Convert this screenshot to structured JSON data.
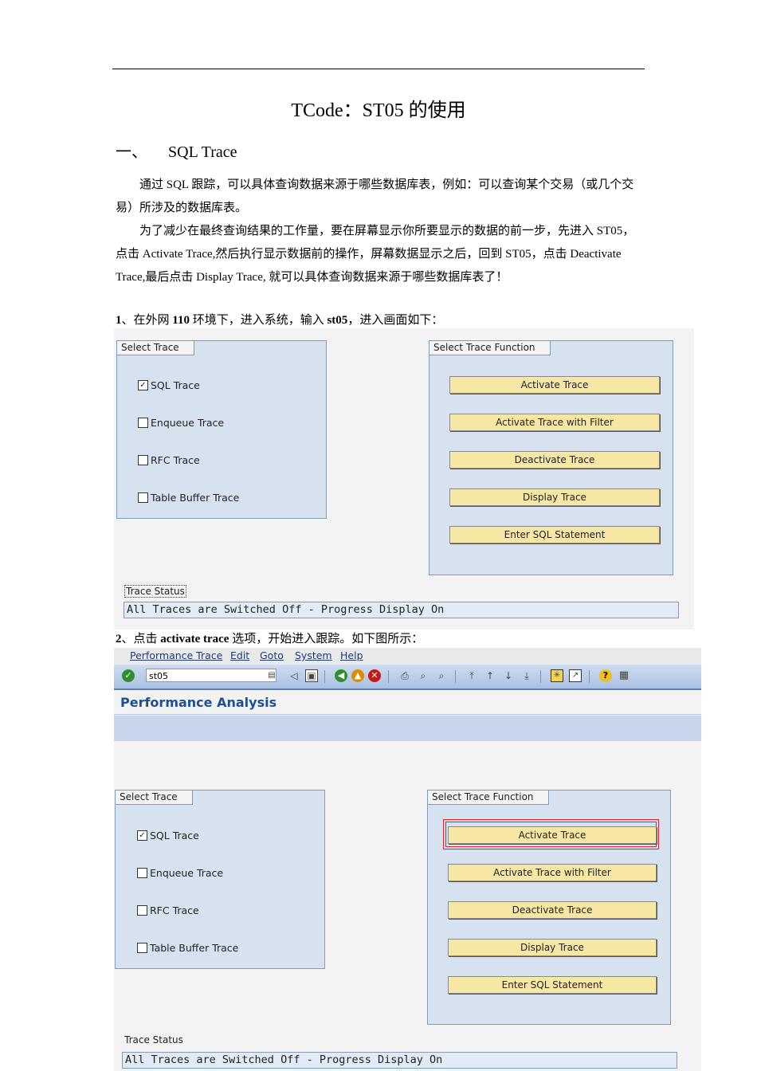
{
  "doc": {
    "title": "TCode：ST05 的使用",
    "section_number": "一、",
    "section_title": "SQL Trace",
    "paragraph1": "通过 SQL 跟踪，可以具体查询数据来源于哪些数据库表，例如：可以查询某个交易（或几个交易）所涉及的数据库表。",
    "paragraph2": "为了减少在最终查询结果的工作量，要在屏幕显示你所要显示的数据的前一步，先进入 ST05，点击 Activate Trace,然后执行显示数据前的操作，屏幕数据显示之后，回到 ST05，点击 Deactivate Trace,最后点击 Display Trace, 就可以具体查询数据来源于哪些数据库表了！",
    "step1": {
      "num": "1",
      "t1": "、在外网 ",
      "b1": "110",
      "t2": " 环境下，进入系统，输入 ",
      "b2": "st05",
      "t3": "，进入画面如下："
    },
    "step2": {
      "num": "2",
      "t1": "、点击 ",
      "b1": "activate trace",
      "t2": " 选项，开始进入跟踪。如下图所示："
    }
  },
  "sap": {
    "select_trace_title": "Select Trace",
    "select_function_title": "Select Trace Function",
    "checkboxes": [
      {
        "label": "SQL Trace",
        "checked": true
      },
      {
        "label": "Enqueue Trace",
        "checked": false
      },
      {
        "label": "RFC Trace",
        "checked": false
      },
      {
        "label": "Table Buffer Trace",
        "checked": false
      }
    ],
    "buttons": [
      "Activate Trace",
      "Activate Trace with Filter",
      "Deactivate Trace",
      "Display Trace",
      "Enter SQL Statement"
    ],
    "status_label": "Trace Status",
    "status_value": "All Traces are Switched Off - Progress Display On",
    "menu": [
      "Performance Trace",
      "Edit",
      "Goto",
      "System",
      "Help"
    ],
    "command_value": "st05",
    "screen_title": "Performance Analysis",
    "highlight_color": "#e0202a",
    "check_glyph": "✓"
  }
}
